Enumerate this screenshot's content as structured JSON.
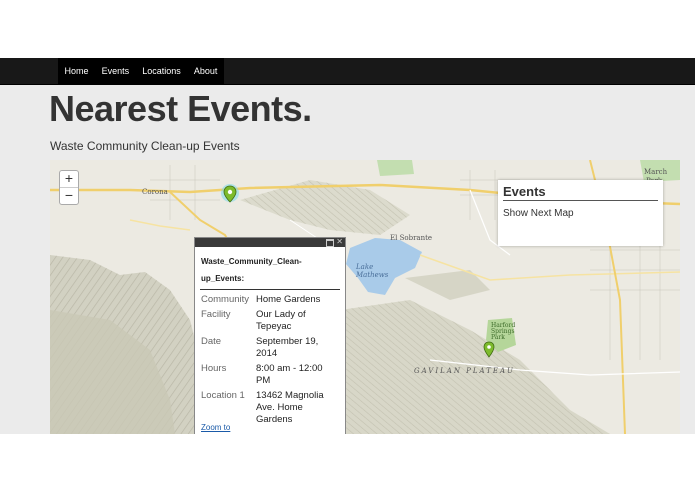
{
  "nav": {
    "items": [
      {
        "label": "Home"
      },
      {
        "label": "Events"
      },
      {
        "label": "Locations"
      },
      {
        "label": "About"
      }
    ]
  },
  "page": {
    "title": "Nearest Events.",
    "subtitle": "Waste Community Clean-up Events"
  },
  "map": {
    "zoom_in": "+",
    "zoom_out": "−",
    "labels": {
      "corona": "Corona",
      "lake_mathews": "Lake\nMathews",
      "el_sobrante": "El Sobrante",
      "gavilan_plateau": "GAVILAN PLATEAU",
      "march": "March",
      "park": "Park",
      "harford_springs_park": "Harford\nSprings\nPark"
    },
    "colors": {
      "water": "#a9cbe9",
      "park": "#b5d69a",
      "terrain": "#d4d3c5",
      "road": "#f0cf6c",
      "marker": "#7dbb2c"
    }
  },
  "events_panel": {
    "title": "Events",
    "link": "Show Next Map"
  },
  "popup": {
    "heading": "Waste_Community_Clean-up_Events:",
    "rows": [
      {
        "key": "Community",
        "value": "Home Gardens"
      },
      {
        "key": "Facility",
        "value": "Our Lady of Tepeyac"
      },
      {
        "key": "Date",
        "value": "September 19, 2014"
      },
      {
        "key": "Hours",
        "value": "8:00 am - 12:00 PM"
      },
      {
        "key": "Location 1",
        "value": "13462 Magnolia Ave. Home Gardens"
      }
    ],
    "zoom_link": "Zoom to"
  }
}
